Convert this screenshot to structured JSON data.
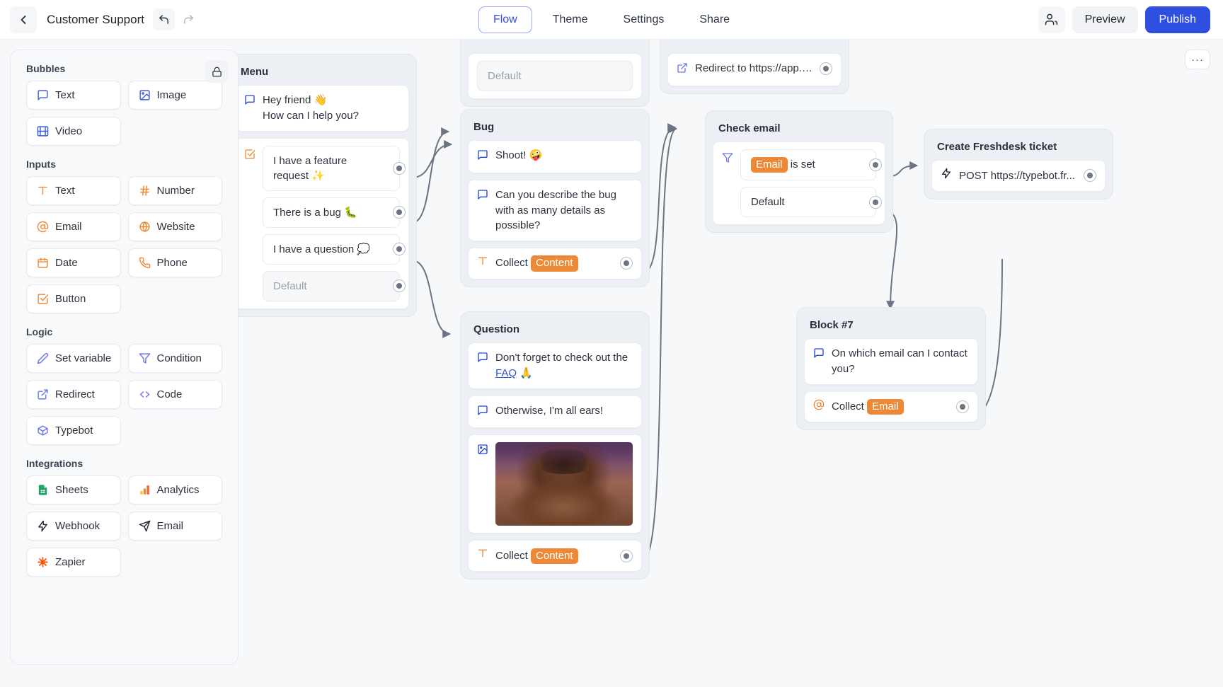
{
  "header": {
    "back_icon": "chevron-left-icon",
    "bot_name": "Customer Support",
    "undo_icon": "undo-icon",
    "redo_icon": "redo-icon",
    "tabs": [
      {
        "label": "Flow",
        "active": true
      },
      {
        "label": "Theme",
        "active": false
      },
      {
        "label": "Settings",
        "active": false
      },
      {
        "label": "Share",
        "active": false
      }
    ],
    "collaborators_icon": "users-icon",
    "preview_label": "Preview",
    "publish_label": "Publish",
    "accent_color": "#2f4fe0"
  },
  "palette": {
    "lock_icon": "lock-icon",
    "sections": [
      {
        "title": "Bubbles",
        "items": [
          {
            "label": "Text",
            "icon": "chat-bubble-icon",
            "color": "#3b5bdb"
          },
          {
            "label": "Image",
            "icon": "image-icon",
            "color": "#3b5bdb"
          },
          {
            "label": "Video",
            "icon": "film-icon",
            "color": "#3b5bdb"
          }
        ]
      },
      {
        "title": "Inputs",
        "items": [
          {
            "label": "Text",
            "icon": "text-t-icon",
            "color": "#ed8936"
          },
          {
            "label": "Number",
            "icon": "hash-icon",
            "color": "#ed8936"
          },
          {
            "label": "Email",
            "icon": "at-sign-icon",
            "color": "#ed8936"
          },
          {
            "label": "Website",
            "icon": "globe-icon",
            "color": "#ed8936"
          },
          {
            "label": "Date",
            "icon": "calendar-icon",
            "color": "#ed8936"
          },
          {
            "label": "Phone",
            "icon": "phone-icon",
            "color": "#ed8936"
          },
          {
            "label": "Button",
            "icon": "checkbox-icon",
            "color": "#ed8936"
          }
        ]
      },
      {
        "title": "Logic",
        "items": [
          {
            "label": "Set variable",
            "icon": "pencil-icon",
            "color": "#6b76e8"
          },
          {
            "label": "Condition",
            "icon": "filter-icon",
            "color": "#6b76e8"
          },
          {
            "label": "Redirect",
            "icon": "external-link-icon",
            "color": "#6b76e8"
          },
          {
            "label": "Code",
            "icon": "code-icon",
            "color": "#6b76e8"
          },
          {
            "label": "Typebot",
            "icon": "cube-icon",
            "color": "#6b76e8"
          }
        ]
      },
      {
        "title": "Integrations",
        "items": [
          {
            "label": "Sheets",
            "icon": "google-sheets-icon",
            "color": "#21a366"
          },
          {
            "label": "Analytics",
            "icon": "google-analytics-icon",
            "color": "#f5a623"
          },
          {
            "label": "Webhook",
            "icon": "lightning-icon",
            "color": "#1f2630"
          },
          {
            "label": "Email",
            "icon": "paper-plane-icon",
            "color": "#1f2630"
          },
          {
            "label": "Zapier",
            "icon": "zapier-icon",
            "color": "#ff4f00"
          }
        ]
      }
    ]
  },
  "canvas": {
    "more_button_label": "···",
    "groups": {
      "partial_top_left": {
        "nodes": [
          {
            "kind": "choice-placeholder",
            "text": "Default"
          }
        ]
      },
      "partial_top_redirect": {
        "nodes": [
          {
            "kind": "redirect",
            "icon": "external-link-icon",
            "text": "Redirect to https://app.typ..."
          }
        ]
      },
      "menu": {
        "title": "Menu",
        "bubble": {
          "icon": "chat-bubble-icon",
          "line1": "Hey friend 👋",
          "line2": "How can I help you?"
        },
        "buttons_icon": "checkbox-icon",
        "choices": [
          {
            "text": "I have a feature request ✨",
            "placeholder": false
          },
          {
            "text": "There is a bug 🐛",
            "placeholder": false
          },
          {
            "text": "I have a question 💭",
            "placeholder": false
          },
          {
            "text": "Default",
            "placeholder": true
          }
        ]
      },
      "bug": {
        "title": "Bug",
        "nodes": [
          {
            "kind": "text",
            "icon": "chat-bubble-icon",
            "text": "Shoot! 🤪"
          },
          {
            "kind": "text",
            "icon": "chat-bubble-icon",
            "text": "Can you describe the bug with as many details as possible?"
          },
          {
            "kind": "input",
            "icon": "text-t-icon",
            "prefix": "Collect",
            "variable": "Content"
          }
        ]
      },
      "question": {
        "title": "Question",
        "nodes": [
          {
            "kind": "text-link",
            "icon": "chat-bubble-icon",
            "text_before": "Don't forget to check out the ",
            "link_text": "FAQ",
            "text_after": " 🙏"
          },
          {
            "kind": "text",
            "icon": "chat-bubble-icon",
            "text": "Otherwise, I'm all ears!"
          },
          {
            "kind": "image",
            "icon": "image-icon",
            "alt": "animated gif of a man holding his head"
          },
          {
            "kind": "input",
            "icon": "text-t-icon",
            "prefix": "Collect",
            "variable": "Content"
          }
        ]
      },
      "check_email": {
        "title": "Check email",
        "condition_icon": "filter-icon",
        "items": [
          {
            "kind": "condition",
            "variable": "Email",
            "text": "is set",
            "placeholder": false
          },
          {
            "kind": "condition",
            "text": "Default",
            "placeholder": true
          }
        ]
      },
      "create_freshdesk_ticket": {
        "title": "Create Freshdesk ticket",
        "nodes": [
          {
            "kind": "webhook",
            "icon": "lightning-icon",
            "text": "POST https://typebot.fr..."
          }
        ]
      },
      "block_7": {
        "title": "Block #7",
        "nodes": [
          {
            "kind": "text",
            "icon": "chat-bubble-icon",
            "text": "On which email can I contact you?"
          },
          {
            "kind": "input",
            "icon": "at-sign-icon",
            "prefix": "Collect",
            "variable": "Email"
          }
        ]
      }
    }
  }
}
